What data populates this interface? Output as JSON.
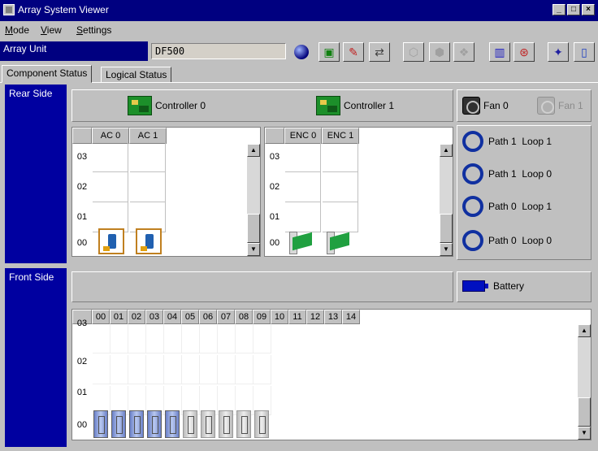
{
  "window": {
    "title": "Array System Viewer",
    "minimize": "_",
    "restore": "□",
    "close": "×"
  },
  "menu": [
    {
      "label": "Mode",
      "u": "M",
      "rest": "ode"
    },
    {
      "label": "View",
      "u": "V",
      "rest": "iew"
    },
    {
      "label": "Settings",
      "u": "S",
      "rest": "ettings"
    }
  ],
  "toolbar": {
    "unit_label": "Array Unit",
    "unit_value": "DF500"
  },
  "tabs": {
    "component_status": "Component Status",
    "logical_status": "Logical Status"
  },
  "rear": {
    "label": "Rear Side",
    "controllers": [
      "Controller 0",
      "Controller 1"
    ],
    "fans": [
      "Fan 0",
      "Fan 1"
    ],
    "ac": {
      "columns": [
        "AC 0",
        "AC 1"
      ],
      "rows": [
        "03",
        "02",
        "01",
        "00"
      ]
    },
    "enc": {
      "columns": [
        "ENC 0",
        "ENC 1"
      ],
      "rows": [
        "03",
        "02",
        "01",
        "00"
      ]
    },
    "paths": [
      "Path 1  Loop 1",
      "Path 1  Loop 0",
      "Path 0  Loop 1",
      "Path 0  Loop 0"
    ]
  },
  "front": {
    "label": "Front Side",
    "battery": "Battery",
    "columns": [
      "00",
      "01",
      "02",
      "03",
      "04",
      "05",
      "06",
      "07",
      "08",
      "09",
      "10",
      "11",
      "12",
      "13",
      "14"
    ],
    "rows": [
      "03",
      "02",
      "01",
      "00"
    ],
    "disks_installed_active": 5,
    "disks_installed_inactive": 5
  },
  "colors": {
    "titlebar": "#000080",
    "side_label": "#0000a0",
    "background": "#c0c0c0"
  }
}
